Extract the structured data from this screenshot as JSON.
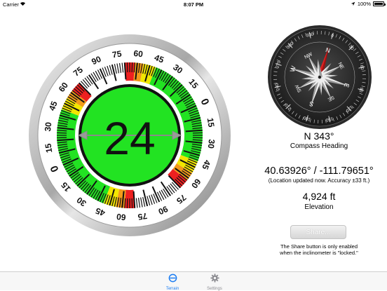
{
  "status_bar": {
    "carrier": "Carrier",
    "time": "8:07 PM",
    "battery": "100%"
  },
  "inclinometer": {
    "reading": "24",
    "scale_left": [
      "90",
      "75",
      "60",
      "45",
      "30",
      "15",
      "0",
      "15",
      "30",
      "45",
      "60",
      "75",
      "90"
    ],
    "scale_right": [
      "60",
      "45",
      "30",
      "15",
      "0",
      "15",
      "30",
      "45",
      "60"
    ]
  },
  "compass": {
    "cardinals": [
      "N",
      "NE",
      "E",
      "SE",
      "S",
      "SW",
      "W",
      "NW"
    ],
    "degrees": [
      "0",
      "30",
      "60",
      "90",
      "120",
      "150",
      "180",
      "210",
      "240",
      "270",
      "300",
      "330"
    ],
    "heading_deg": 343
  },
  "heading": {
    "value": "N 343°",
    "label": "Compass Heading"
  },
  "location": {
    "coords": "40.63926° / -111.79651°",
    "note": "(Location updated now. Accuracy ±33 ft.)"
  },
  "elevation": {
    "value": "4,924 ft",
    "label": "Elevation"
  },
  "share": {
    "label": "Share...",
    "note_line1": "The Share button is only enabled",
    "note_line2": "when the inclinometer is \"locked.\""
  },
  "tabs": [
    {
      "label": "Terrain",
      "icon": "inclinometer-icon"
    },
    {
      "label": "Settings",
      "icon": "gear-icon"
    }
  ],
  "colors": {
    "accent": "#1a7cf2",
    "level_green": "#22e322",
    "warn_yellow": "#f2e600",
    "warn_orange": "#f29a1a",
    "danger_red": "#ee2020"
  }
}
